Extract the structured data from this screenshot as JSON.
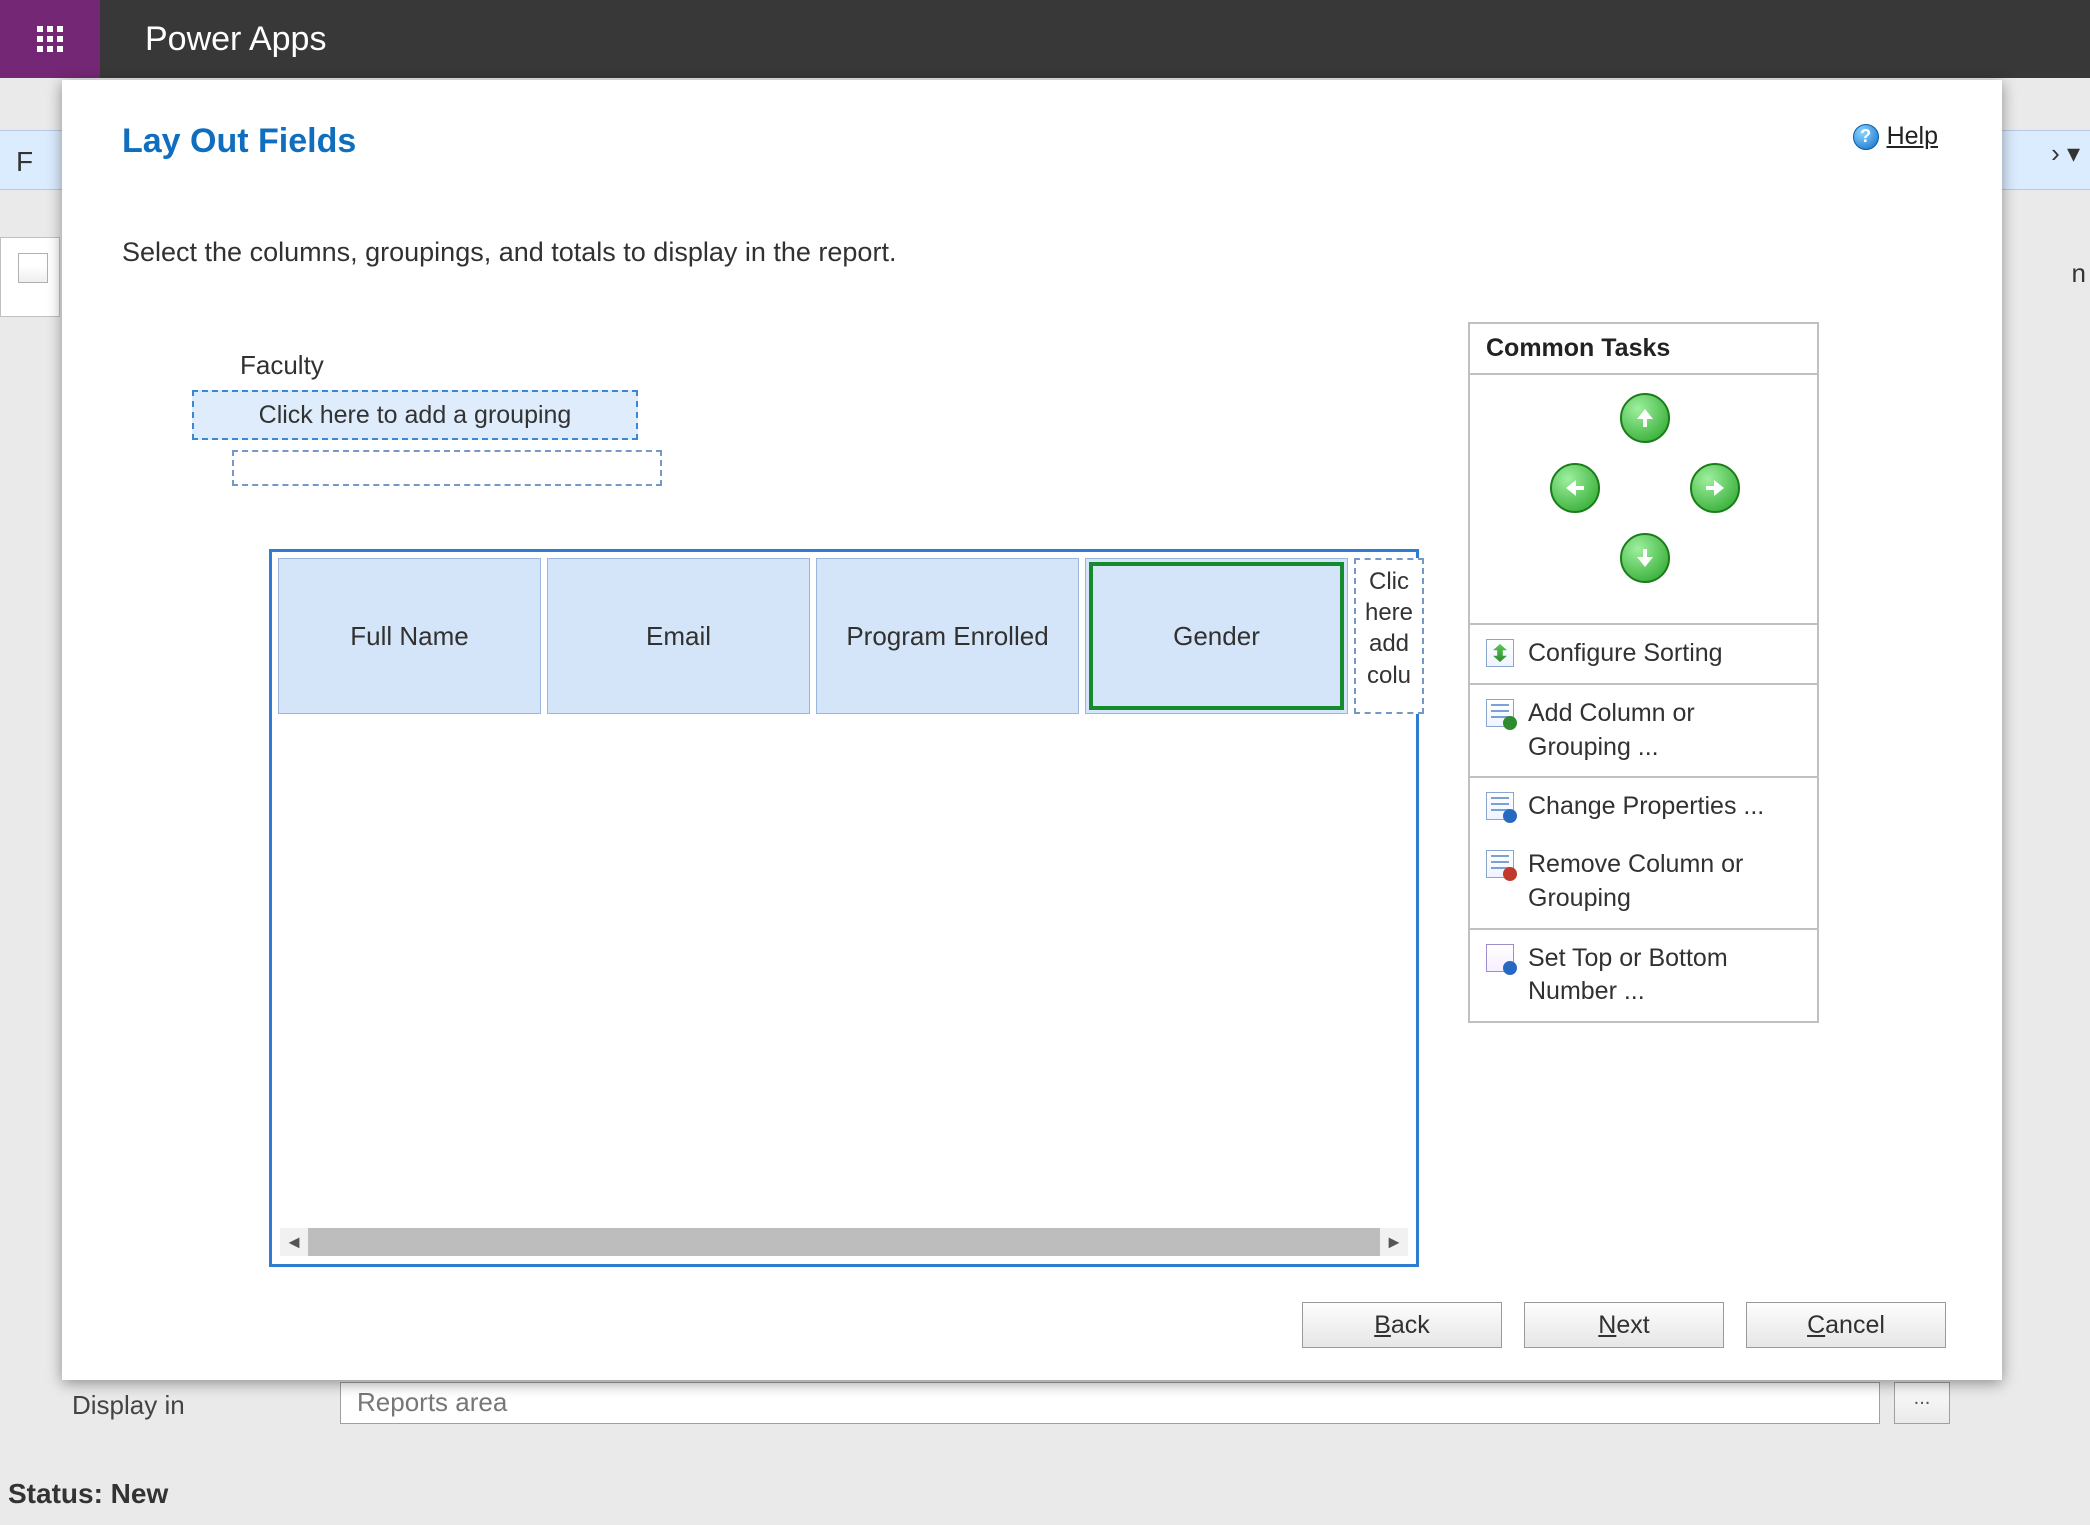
{
  "app": {
    "title": "Power Apps"
  },
  "background": {
    "ribbon_letter": "F",
    "right_trunc": "n",
    "right_trunc_top": "› ▾",
    "display_in_label": "Display in",
    "display_in_value": "Reports area",
    "more_btn": "..."
  },
  "status": {
    "text": "Status: New"
  },
  "dialog": {
    "title": "Lay Out Fields",
    "subtitle": "Select the columns, groupings, and totals to display in the report.",
    "help": "Help"
  },
  "designer": {
    "entity_label": "Faculty",
    "add_grouping_text": "Click here to add a grouping",
    "columns": [
      "Full Name",
      "Email",
      "Program Enrolled",
      "Gender"
    ],
    "selected_column_index": 3,
    "add_column_text": "Click here to add a column"
  },
  "tasks": {
    "header": "Common Tasks",
    "configure_sorting": "Configure Sorting",
    "add_column": "Add Column or Grouping ...",
    "change_properties": "Change Properties ...",
    "remove": "Remove Column or Grouping",
    "set_topbottom": "Set Top or Bottom Number ..."
  },
  "wizard": {
    "back": "Back",
    "next": "Next",
    "cancel": "Cancel"
  }
}
